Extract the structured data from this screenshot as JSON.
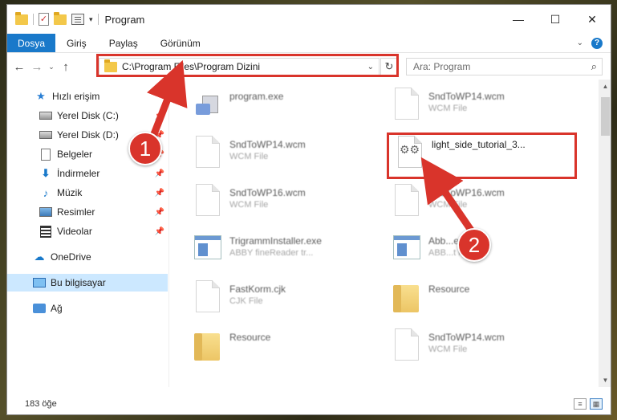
{
  "window": {
    "title": "Program",
    "controls": {
      "minimize": "—",
      "maximize": "☐",
      "close": "✕"
    }
  },
  "ribbon": {
    "tabs": [
      {
        "label": "Dosya",
        "active": true
      },
      {
        "label": "Giriş",
        "active": false
      },
      {
        "label": "Paylaş",
        "active": false
      },
      {
        "label": "Görünüm",
        "active": false
      }
    ]
  },
  "navigation": {
    "address": "C:\\Program Files\\Program Dizini",
    "search_placeholder": "Ara: Program"
  },
  "sidebar": {
    "items": [
      {
        "label": "Hızlı erişim",
        "icon": "star-icon"
      },
      {
        "label": "Yerel Disk (C:)",
        "icon": "disk-icon",
        "pinned": true
      },
      {
        "label": "Yerel Disk (D:)",
        "icon": "disk-icon",
        "pinned": true
      },
      {
        "label": "Belgeler",
        "icon": "documents-icon",
        "pinned": true
      },
      {
        "label": "İndirmeler",
        "icon": "downloads-icon",
        "pinned": true
      },
      {
        "label": "Müzik",
        "icon": "music-icon",
        "pinned": true
      },
      {
        "label": "Resimler",
        "icon": "pictures-icon",
        "pinned": true
      },
      {
        "label": "Videolar",
        "icon": "videos-icon",
        "pinned": true
      },
      {
        "label": "OneDrive",
        "icon": "cloud-icon"
      },
      {
        "label": "Bu bilgisayar",
        "icon": "computer-icon",
        "selected": true
      },
      {
        "label": "Ağ",
        "icon": "network-icon"
      }
    ]
  },
  "files": [
    {
      "name": "program.exe",
      "type": "",
      "kind": "setup"
    },
    {
      "name": "SndToWP14.wcm",
      "type": "WCM File",
      "kind": "doc"
    },
    {
      "name": "SndToWP14.wcm",
      "type": "WCM File",
      "kind": "doc"
    },
    {
      "name": "light_side_tutorial_3...",
      "type": "",
      "kind": "gear-doc",
      "highlight": true
    },
    {
      "name": "SndToWP16.wcm",
      "type": "WCM File",
      "kind": "doc"
    },
    {
      "name": "SndToWP16.wcm",
      "type": "WCM File",
      "kind": "doc"
    },
    {
      "name": "TrigrammInstaller.exe",
      "type": "ABBY fineReader tr...",
      "kind": "exe"
    },
    {
      "name": "Abb...e",
      "type": "ABB...t hand...",
      "kind": "exe"
    },
    {
      "name": "FastKorm.cjk",
      "type": "CJK File",
      "kind": "doc"
    },
    {
      "name": "Resource",
      "type": "",
      "kind": "folder"
    },
    {
      "name": "Resource",
      "type": "",
      "kind": "folder"
    },
    {
      "name": "SndToWP14.wcm",
      "type": "WCM File",
      "kind": "doc"
    }
  ],
  "status": {
    "count": "183 öğe"
  },
  "annotations": {
    "step1": "1",
    "step2": "2",
    "color": "#d9342b"
  }
}
